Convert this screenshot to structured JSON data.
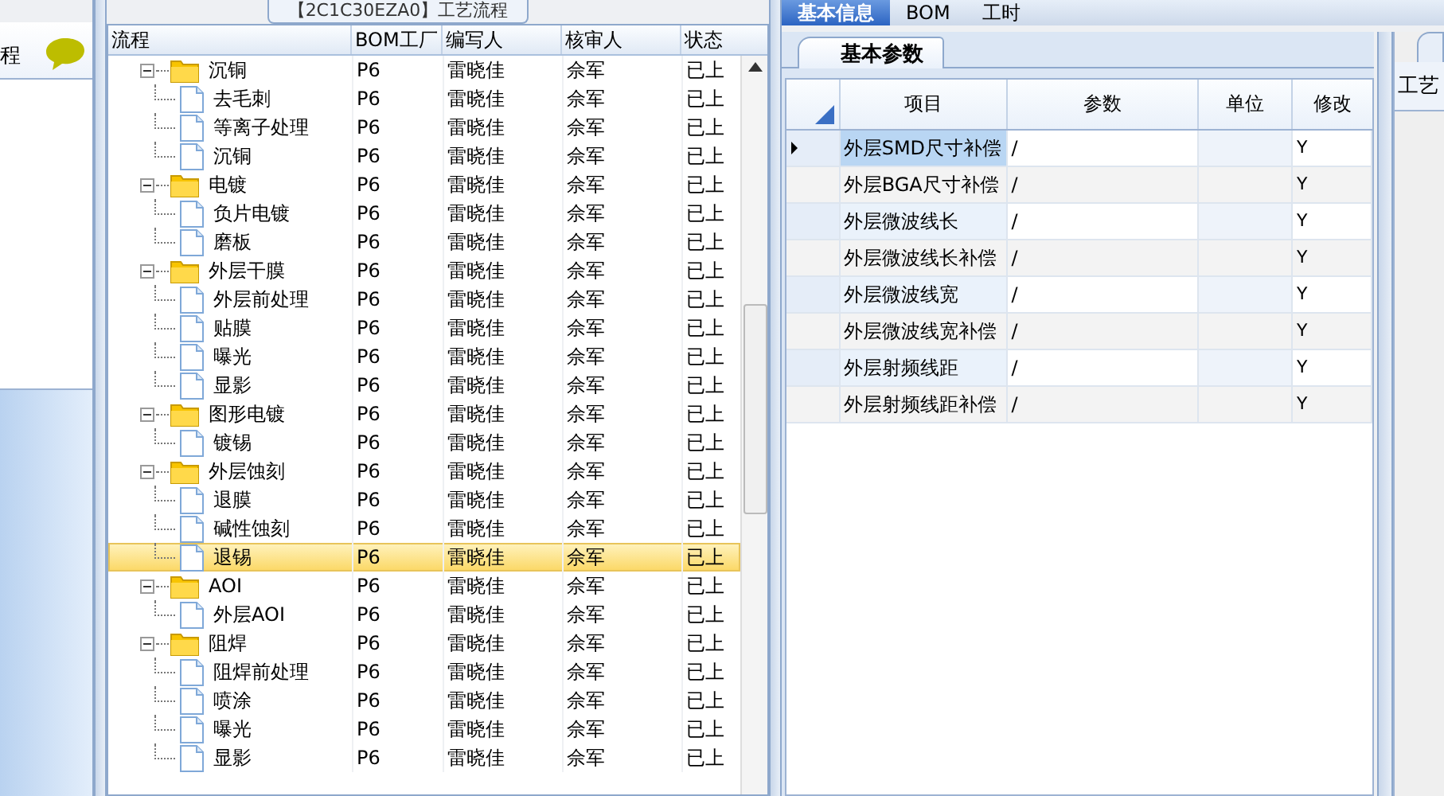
{
  "left_panel": {
    "title": "程"
  },
  "flow_tab": {
    "title": "【2C1C30EZA0】工艺流程"
  },
  "tree_grid": {
    "columns": [
      "流程",
      "BOM工厂",
      "编写人",
      "核审人",
      "状态"
    ],
    "nodes": [
      {
        "kind": "folder",
        "name": "沉铜",
        "bom": "P6",
        "writer": "雷晓佳",
        "reviewer": "佘军",
        "status": "已上",
        "expanded": true,
        "selected": false,
        "children": [
          {
            "kind": "step",
            "name": "去毛刺",
            "bom": "P6",
            "writer": "雷晓佳",
            "reviewer": "佘军",
            "status": "已上",
            "selected": false
          },
          {
            "kind": "step",
            "name": "等离子处理",
            "bom": "P6",
            "writer": "雷晓佳",
            "reviewer": "佘军",
            "status": "已上",
            "selected": false
          },
          {
            "kind": "step",
            "name": "沉铜",
            "bom": "P6",
            "writer": "雷晓佳",
            "reviewer": "佘军",
            "status": "已上",
            "selected": false
          }
        ]
      },
      {
        "kind": "folder",
        "name": "电镀",
        "bom": "P6",
        "writer": "雷晓佳",
        "reviewer": "佘军",
        "status": "已上",
        "expanded": true,
        "selected": false,
        "children": [
          {
            "kind": "step",
            "name": "负片电镀",
            "bom": "P6",
            "writer": "雷晓佳",
            "reviewer": "佘军",
            "status": "已上",
            "selected": false
          },
          {
            "kind": "step",
            "name": "磨板",
            "bom": "P6",
            "writer": "雷晓佳",
            "reviewer": "佘军",
            "status": "已上",
            "selected": false
          }
        ]
      },
      {
        "kind": "folder",
        "name": "外层干膜",
        "bom": "P6",
        "writer": "雷晓佳",
        "reviewer": "佘军",
        "status": "已上",
        "expanded": true,
        "selected": false,
        "children": [
          {
            "kind": "step",
            "name": "外层前处理",
            "bom": "P6",
            "writer": "雷晓佳",
            "reviewer": "佘军",
            "status": "已上",
            "selected": false
          },
          {
            "kind": "step",
            "name": "贴膜",
            "bom": "P6",
            "writer": "雷晓佳",
            "reviewer": "佘军",
            "status": "已上",
            "selected": false
          },
          {
            "kind": "step",
            "name": "曝光",
            "bom": "P6",
            "writer": "雷晓佳",
            "reviewer": "佘军",
            "status": "已上",
            "selected": false
          },
          {
            "kind": "step",
            "name": "显影",
            "bom": "P6",
            "writer": "雷晓佳",
            "reviewer": "佘军",
            "status": "已上",
            "selected": false
          }
        ]
      },
      {
        "kind": "folder",
        "name": "图形电镀",
        "bom": "P6",
        "writer": "雷晓佳",
        "reviewer": "佘军",
        "status": "已上",
        "expanded": true,
        "selected": false,
        "children": [
          {
            "kind": "step",
            "name": "镀锡",
            "bom": "P6",
            "writer": "雷晓佳",
            "reviewer": "佘军",
            "status": "已上",
            "selected": false
          }
        ]
      },
      {
        "kind": "folder",
        "name": "外层蚀刻",
        "bom": "P6",
        "writer": "雷晓佳",
        "reviewer": "佘军",
        "status": "已上",
        "expanded": true,
        "selected": false,
        "children": [
          {
            "kind": "step",
            "name": "退膜",
            "bom": "P6",
            "writer": "雷晓佳",
            "reviewer": "佘军",
            "status": "已上",
            "selected": false
          },
          {
            "kind": "step",
            "name": "碱性蚀刻",
            "bom": "P6",
            "writer": "雷晓佳",
            "reviewer": "佘军",
            "status": "已上",
            "selected": false
          },
          {
            "kind": "step",
            "name": "退锡",
            "bom": "P6",
            "writer": "雷晓佳",
            "reviewer": "佘军",
            "status": "已上",
            "selected": true
          }
        ]
      },
      {
        "kind": "folder",
        "name": "AOI",
        "bom": "P6",
        "writer": "雷晓佳",
        "reviewer": "佘军",
        "status": "已上",
        "expanded": true,
        "selected": false,
        "children": [
          {
            "kind": "step",
            "name": "外层AOI",
            "bom": "P6",
            "writer": "雷晓佳",
            "reviewer": "佘军",
            "status": "已上",
            "selected": false
          }
        ]
      },
      {
        "kind": "folder",
        "name": "阻焊",
        "bom": "P6",
        "writer": "雷晓佳",
        "reviewer": "佘军",
        "status": "已上",
        "expanded": true,
        "selected": false,
        "children": [
          {
            "kind": "step",
            "name": "阻焊前处理",
            "bom": "P6",
            "writer": "雷晓佳",
            "reviewer": "佘军",
            "status": "已上",
            "selected": false
          },
          {
            "kind": "step",
            "name": "喷涂",
            "bom": "P6",
            "writer": "雷晓佳",
            "reviewer": "佘军",
            "status": "已上",
            "selected": false
          },
          {
            "kind": "step",
            "name": "曝光",
            "bom": "P6",
            "writer": "雷晓佳",
            "reviewer": "佘军",
            "status": "已上",
            "selected": false
          },
          {
            "kind": "step",
            "name": "显影",
            "bom": "P6",
            "writer": "雷晓佳",
            "reviewer": "佘军",
            "status": "已上",
            "selected": false
          }
        ]
      }
    ]
  },
  "main_tabs": [
    {
      "label": "基本信息",
      "selected": true
    },
    {
      "label": "BOM",
      "selected": false
    },
    {
      "label": "工时",
      "selected": false
    }
  ],
  "sub_tabs": [
    {
      "label": "基本参数",
      "selected": true
    }
  ],
  "param_grid": {
    "columns": [
      "项目",
      "参数",
      "单位",
      "修改"
    ],
    "rows": [
      {
        "item": "外层SMD尺寸补偿",
        "value": "/",
        "modify": "Y",
        "selected": true
      },
      {
        "item": "外层BGA尺寸补偿",
        "value": "/",
        "modify": "Y",
        "selected": false
      },
      {
        "item": "外层微波线长",
        "value": "/",
        "modify": "Y",
        "selected": false
      },
      {
        "item": "外层微波线长补偿",
        "value": "/",
        "modify": "Y",
        "selected": false
      },
      {
        "item": "外层微波线宽",
        "value": "/",
        "modify": "Y",
        "selected": false
      },
      {
        "item": "外层微波线宽补偿",
        "value": "/",
        "modify": "Y",
        "selected": false
      },
      {
        "item": "外层射频线距",
        "value": "/",
        "modify": "Y",
        "selected": false
      },
      {
        "item": "外层射频线距补偿",
        "value": "/",
        "modify": "Y",
        "selected": false
      }
    ]
  },
  "right_panel": {
    "label": "工艺"
  }
}
